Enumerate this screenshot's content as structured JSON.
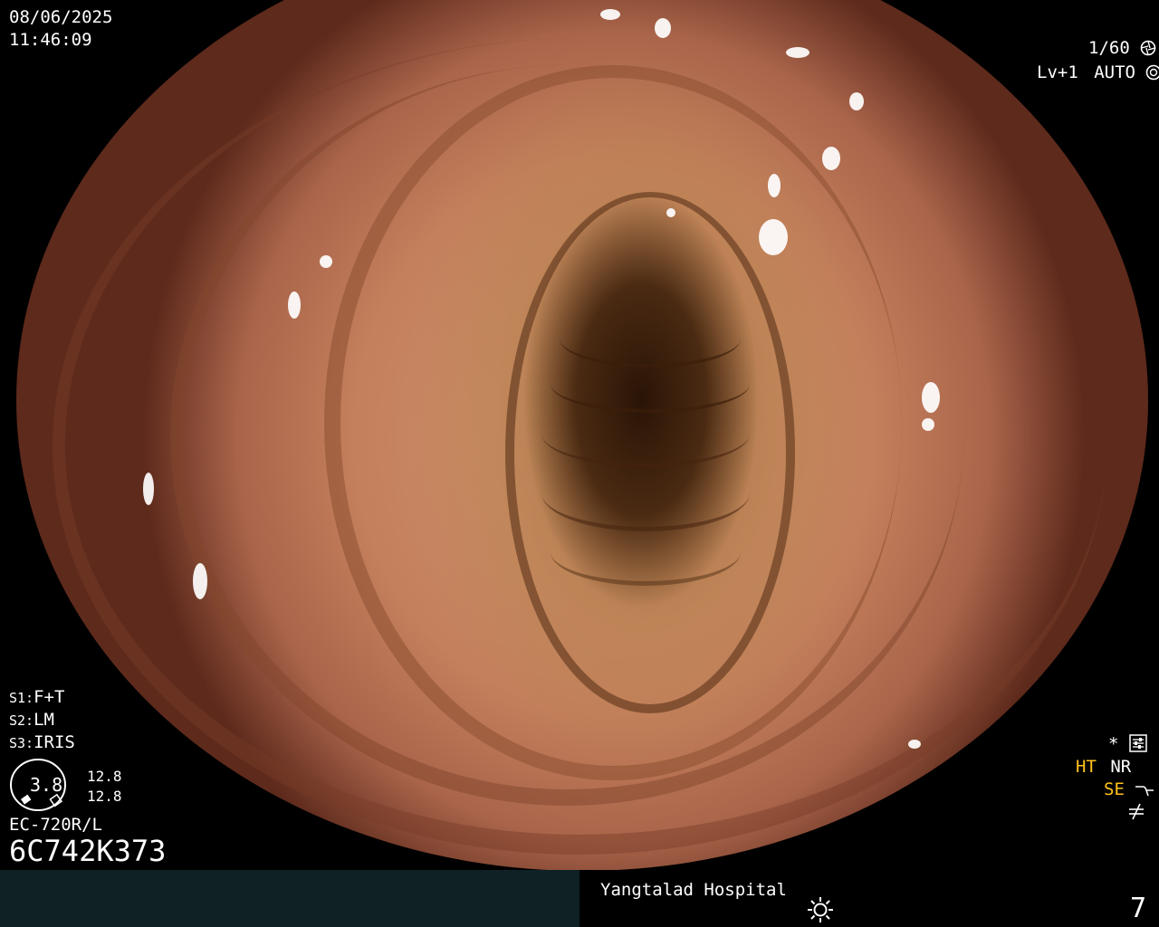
{
  "datetime": {
    "date": "08/06/2025",
    "time": "11:46:09"
  },
  "top_right": {
    "shutter": "1/60",
    "level": "Lv+1",
    "mode": "AUTO"
  },
  "settings": [
    {
      "key": "S1:",
      "value": "F+T"
    },
    {
      "key": "S2:",
      "value": "LM"
    },
    {
      "key": "S3:",
      "value": "IRIS"
    }
  ],
  "gauge": {
    "value": "3.8",
    "upper": "12.8",
    "lower": "12.8"
  },
  "scope": {
    "model": "EC-720R/L",
    "serial": "6C742K373"
  },
  "status_right": {
    "asterisk": "*",
    "ht": "HT",
    "nr": "NR",
    "se": "SE"
  },
  "footer": {
    "hospital": "Yangtalad Hospital",
    "image_number": "7"
  },
  "icons": {
    "shutter": "aperture-icon",
    "auto": "exposure-icon",
    "settings": "settings-sliders-icon",
    "se": "enhance-curve-icon",
    "freeze": "not-equal-icon",
    "light": "sun-icon"
  },
  "colors": {
    "accent": "#ffc21c",
    "footer_panel": "#0f2124"
  }
}
